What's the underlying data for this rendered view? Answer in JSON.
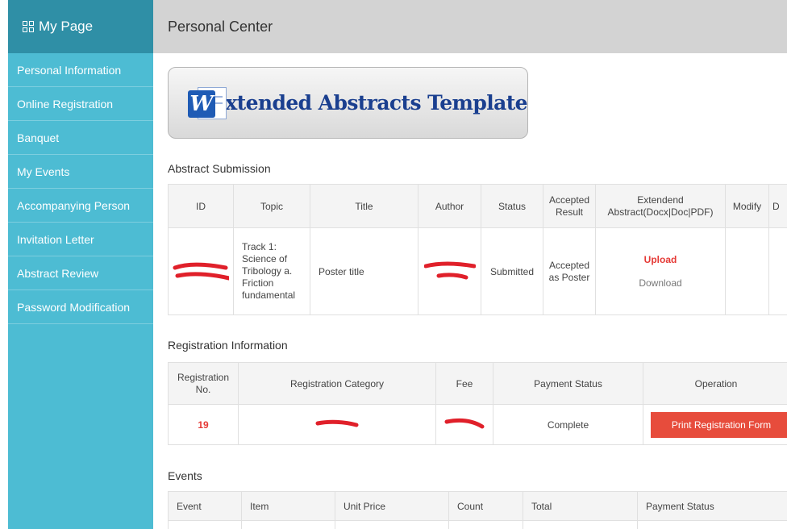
{
  "sidebar": {
    "title": "My Page",
    "items": [
      {
        "label": "Personal Information"
      },
      {
        "label": "Online Registration"
      },
      {
        "label": "Banquet"
      },
      {
        "label": "My Events"
      },
      {
        "label": "Accompanying Person"
      },
      {
        "label": "Invitation Letter"
      },
      {
        "label": "Abstract Review"
      },
      {
        "label": "Password Modification"
      }
    ]
  },
  "header": {
    "title": "Personal Center"
  },
  "template": {
    "label": "Extended Abstracts Template",
    "icon": "word-icon"
  },
  "abstract_submission": {
    "title": "Abstract Submission",
    "columns": [
      "ID",
      "Topic",
      "Title",
      "Author",
      "Status",
      "Accepted Result",
      "Extendend Abstract(Docx|Doc|PDF)",
      "Modify",
      "D"
    ],
    "row": {
      "topic": "Track 1: Science of Tribology a. Friction fundamental",
      "title": "Poster title",
      "status": "Submitted",
      "accepted_result": "Accepted as Poster",
      "upload_label": "Upload",
      "download_label": "Download"
    }
  },
  "registration_info": {
    "title": "Registration Information",
    "columns": [
      "Registration No.",
      "Registration Category",
      "Fee",
      "Payment Status",
      "Operation"
    ],
    "row": {
      "reg_no": "19",
      "payment_status": "Complete",
      "print_label": "Print Registration Form"
    }
  },
  "events": {
    "title": "Events",
    "columns": [
      "Event",
      "Item",
      "Unit Price",
      "Count",
      "Total",
      "Payment Status"
    ]
  },
  "colors": {
    "sidebar_bg": "#4dbcd3",
    "sidebar_header_bg": "#2f8fa6",
    "topbar_bg": "#d3d3d3",
    "accent_red": "#e53935",
    "button_red": "#e74c3c"
  }
}
